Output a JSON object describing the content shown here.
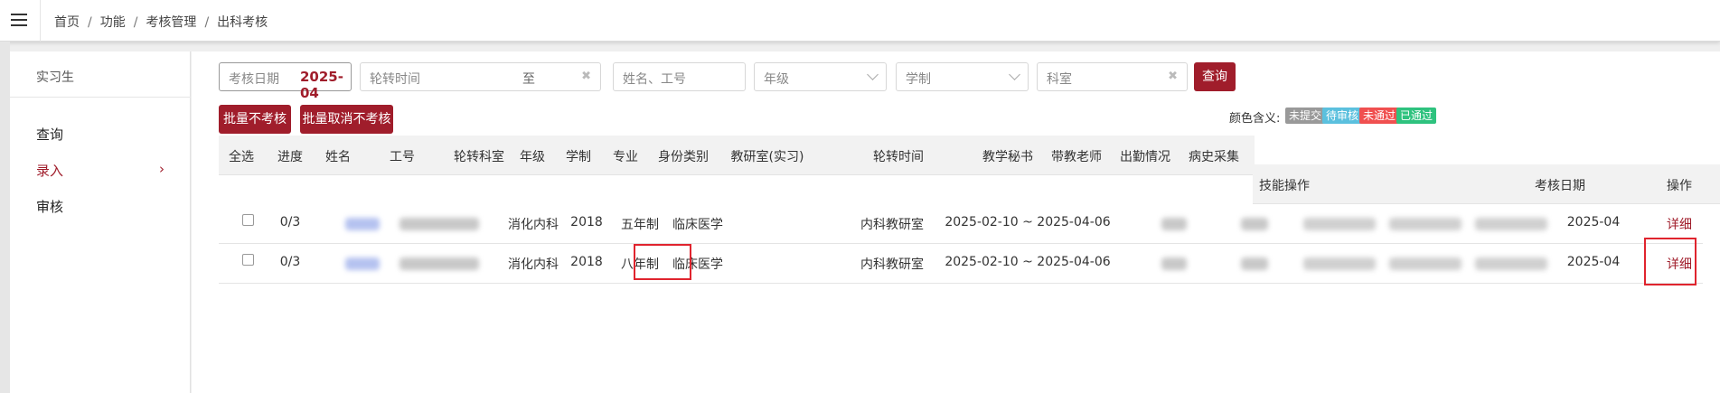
{
  "breadcrumb": [
    "首页",
    "功能",
    "考核管理",
    "出科考核"
  ],
  "sidebar": {
    "title": "实习生",
    "items": [
      {
        "label": "查询"
      },
      {
        "label": "录入",
        "arrow": "›"
      },
      {
        "label": "审核"
      }
    ]
  },
  "filters": {
    "date_label": "考核日期",
    "date_value": "2025-04",
    "rotation_label": "轮转时间",
    "rotation_mid": "至",
    "name_placeholder": "姓名、工号",
    "grade_placeholder": "年级",
    "system_placeholder": "学制",
    "dept_placeholder": "科室",
    "clear_glyph": "✖",
    "search_label": "查询"
  },
  "actions": {
    "batch_exempt": "批量不考核",
    "batch_cancel": "批量取消不考核"
  },
  "legend": {
    "title": "颜色含义:",
    "items": [
      {
        "label": "未提交",
        "color": "#999999"
      },
      {
        "label": "待审核",
        "color": "#5bc0de"
      },
      {
        "label": "未通过",
        "color": "#f05050"
      },
      {
        "label": "已通过",
        "color": "#2ec27e"
      }
    ]
  },
  "table": {
    "headers": [
      "全选",
      "进度",
      "姓名",
      "工号",
      "轮转科室",
      "年级",
      "学制",
      "专业",
      "身份类别",
      "教研室(实习)",
      "轮转时间",
      "教学秘书",
      "带教老师",
      "出勤情况",
      "病史采集",
      "技能操作",
      "考核日期",
      "操作"
    ],
    "rows": [
      {
        "progress": "0/3",
        "dept": "消化内科",
        "grade": "2018",
        "system": "五年制",
        "major": "临床医学",
        "identity": "",
        "office": "内科教研室",
        "period": "2025-02-10 ~ 2025-04-06",
        "exam_date": "2025-04",
        "action": "详细"
      },
      {
        "progress": "0/3",
        "dept": "消化内科",
        "grade": "2018",
        "system": "八年制",
        "major": "临床医学",
        "identity": "",
        "office": "内科教研室",
        "period": "2025-02-10 ~ 2025-04-06",
        "exam_date": "2025-04",
        "action": "详细"
      }
    ]
  },
  "colors": {
    "accent": "#a01d2b",
    "highlight_box": "#e0242e"
  }
}
